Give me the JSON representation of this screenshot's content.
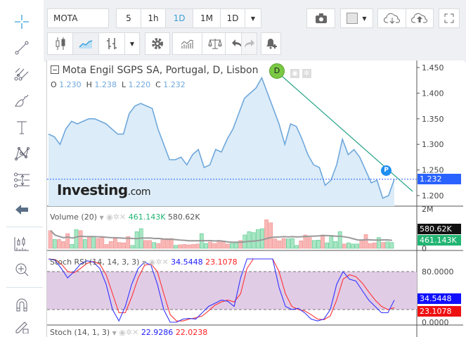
{
  "toolbar": {
    "symbol": "MOTA",
    "intervals": [
      "5",
      "1h",
      "1D",
      "1M",
      "1D"
    ],
    "active_interval": "1D"
  },
  "chart": {
    "title": "Mota Engil SGPS SA, Portugal, D, Lisbon",
    "ohlc": {
      "o_label": "O",
      "o": "1.230",
      "h_label": "H",
      "h": "1.238",
      "l_label": "L",
      "l": "1.220",
      "c_label": "C",
      "c": "1.232"
    },
    "watermark": "Investing",
    "watermark_suffix": ".com",
    "marker_d": "D",
    "marker_p": "P",
    "price_axis": [
      "1.450",
      "1.400",
      "1.350",
      "1.300",
      "1.250",
      "1.200"
    ],
    "last_price": "1.232",
    "closes": [
      1.32,
      1.315,
      1.3,
      1.33,
      1.345,
      1.34,
      1.345,
      1.35,
      1.35,
      1.345,
      1.34,
      1.33,
      1.32,
      1.32,
      1.36,
      1.375,
      1.38,
      1.375,
      1.37,
      1.33,
      1.3,
      1.27,
      1.27,
      1.275,
      1.26,
      1.28,
      1.29,
      1.255,
      1.26,
      1.29,
      1.285,
      1.31,
      1.33,
      1.36,
      1.39,
      1.4,
      1.41,
      1.43,
      1.4,
      1.37,
      1.34,
      1.3,
      1.34,
      1.335,
      1.31,
      1.28,
      1.26,
      1.255,
      1.22,
      1.23,
      1.26,
      1.31,
      1.28,
      1.29,
      1.275,
      1.25,
      1.225,
      1.23,
      1.195,
      1.2,
      1.232
    ],
    "colors": {
      "line": "#6fa8dc",
      "fill": "#dcecf8",
      "trend": "#26a387",
      "last": "#2962ff"
    }
  },
  "volume": {
    "title": "Volume (20)",
    "value": "461.143K",
    "ma": "580.62K",
    "axis": [
      "2M",
      "0"
    ],
    "bars": [
      [
        0.9,
        0
      ],
      [
        0.45,
        1
      ],
      [
        0.45,
        0
      ],
      [
        0.35,
        0
      ],
      [
        0.75,
        0
      ],
      [
        0.2,
        1
      ],
      [
        0.95,
        1
      ],
      [
        0.9,
        0
      ],
      [
        0.45,
        1
      ],
      [
        0.55,
        0
      ],
      [
        0.6,
        1
      ],
      [
        0.5,
        0
      ],
      [
        0.55,
        0
      ],
      [
        0.2,
        0
      ],
      [
        0.35,
        0
      ],
      [
        0.5,
        0
      ],
      [
        0.3,
        0
      ],
      [
        0.28,
        0
      ],
      [
        0.6,
        0
      ],
      [
        0.15,
        1
      ],
      [
        0.85,
        1
      ],
      [
        1.0,
        1
      ],
      [
        0.4,
        0
      ],
      [
        0.4,
        0
      ],
      [
        0.3,
        1
      ],
      [
        0.25,
        0
      ],
      [
        0.45,
        0
      ],
      [
        0.5,
        0
      ],
      [
        0.5,
        0
      ],
      [
        0.15,
        1
      ],
      [
        0.18,
        0
      ],
      [
        0.2,
        0
      ],
      [
        0.18,
        0
      ],
      [
        0.2,
        0
      ],
      [
        0.22,
        0
      ],
      [
        0.75,
        1
      ],
      [
        0.25,
        1
      ],
      [
        0.32,
        0
      ],
      [
        0.25,
        0
      ],
      [
        0.4,
        0
      ],
      [
        0.35,
        0
      ],
      [
        0.22,
        0
      ],
      [
        0.25,
        1
      ],
      [
        0.28,
        1
      ],
      [
        0.4,
        0
      ],
      [
        0.68,
        1
      ],
      [
        0.85,
        1
      ],
      [
        0.8,
        1
      ],
      [
        0.95,
        1
      ],
      [
        1.0,
        1
      ],
      [
        1.45,
        0
      ],
      [
        1.3,
        0
      ],
      [
        0.48,
        0
      ],
      [
        0.38,
        0
      ],
      [
        0.5,
        0
      ],
      [
        0.48,
        1
      ],
      [
        0.5,
        1
      ],
      [
        0.15,
        1
      ],
      [
        0.38,
        0
      ],
      [
        0.68,
        0
      ],
      [
        0.55,
        0
      ],
      [
        0.4,
        1
      ],
      [
        0.42,
        1
      ],
      [
        0.68,
        0
      ],
      [
        0.28,
        1
      ],
      [
        0.58,
        1
      ],
      [
        0.35,
        1
      ],
      [
        0.85,
        1
      ],
      [
        0.22,
        0
      ],
      [
        0.28,
        1
      ],
      [
        0.22,
        1
      ],
      [
        0.22,
        1
      ],
      [
        0.4,
        0
      ],
      [
        0.7,
        0
      ],
      [
        0.25,
        0
      ],
      [
        0.28,
        0
      ],
      [
        0.55,
        1
      ],
      [
        0.3,
        0
      ],
      [
        0.33,
        1
      ],
      [
        0.3,
        1
      ]
    ],
    "colors": {
      "up": "#a8e6c4",
      "down": "#f8b7b5",
      "up_edge": "#3cc07b",
      "down_edge": "#f08080"
    }
  },
  "stoch_rsi": {
    "title": "Stoch RSI (14, 14, 3, 3)",
    "k": "34.5448",
    "d": "23.1078",
    "axis": [
      "80.0000",
      "0.0000"
    ],
    "k_series": [
      100,
      98,
      85,
      70,
      80,
      92,
      97,
      95,
      85,
      60,
      20,
      2,
      25,
      60,
      85,
      95,
      90,
      60,
      20,
      0,
      0,
      5,
      6,
      5,
      15,
      25,
      30,
      35,
      33,
      25,
      70,
      100,
      100,
      100,
      100,
      100,
      55,
      25,
      20,
      22,
      15,
      5,
      2,
      5,
      20,
      60,
      80,
      68,
      65,
      50,
      35,
      25,
      15,
      15,
      35
    ],
    "d_series": [
      100,
      99,
      92,
      80,
      78,
      85,
      93,
      96,
      92,
      75,
      45,
      15,
      15,
      40,
      70,
      90,
      92,
      80,
      45,
      12,
      2,
      2,
      5,
      7,
      10,
      18,
      27,
      32,
      35,
      32,
      45,
      85,
      100,
      100,
      100,
      100,
      80,
      45,
      25,
      20,
      18,
      12,
      5,
      4,
      10,
      35,
      68,
      75,
      72,
      62,
      48,
      35,
      25,
      20,
      23
    ]
  },
  "stoch": {
    "title": "Stoch (14, 1, 3)",
    "k": "22.9286",
    "d": "22.0238"
  }
}
